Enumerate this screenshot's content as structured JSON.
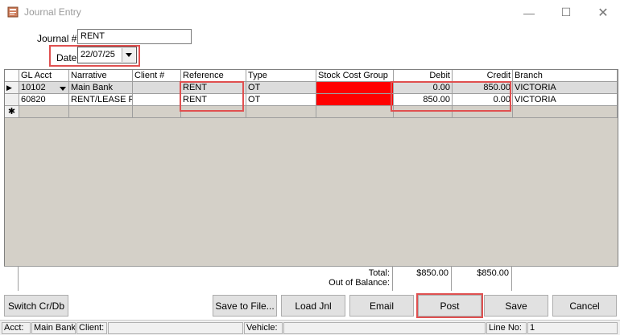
{
  "window": {
    "title": "Journal Entry"
  },
  "form": {
    "journal_label": "Journal #",
    "journal_value": "RENT",
    "date_label": "Date",
    "date_value": "22/07/25"
  },
  "grid": {
    "headers": [
      "GL Acct",
      "Narrative",
      "Client #",
      "Reference",
      "Type",
      "Stock Cost Group",
      "Debit",
      "Credit",
      "Branch"
    ],
    "rows": [
      [
        "10102",
        "Main Bank",
        "",
        "RENT",
        "OT",
        "",
        "0.00",
        "850.00",
        "VICTORIA"
      ],
      [
        "60820",
        "RENT/LEASE PA",
        "",
        "RENT",
        "OT",
        "",
        "850.00",
        "0.00",
        "VICTORIA"
      ]
    ],
    "new_row_marker": "✱",
    "current_row_marker": "▶",
    "totals_label": "Total:",
    "out_of_balance_label": "Out of Balance:",
    "total_debit": "$850.00",
    "total_credit": "$850.00",
    "cost_group_color": "#ff0000"
  },
  "buttons": {
    "switch": "Switch Cr/Db",
    "save_file": "Save to File...",
    "load": "Load Jnl",
    "email": "Email",
    "post": "Post",
    "save": "Save",
    "cancel": "Cancel"
  },
  "status": {
    "acct_label": "Acct:",
    "acct_value": "Main Bank",
    "client_label": "Client:",
    "vehicle_label": "Vehicle:",
    "line_label": "Line No:",
    "line_value": "1"
  },
  "icons": {
    "app": "journal-app-icon",
    "dropdown": "dropdown-arrow-icon"
  },
  "highlight_color": "#e05050"
}
